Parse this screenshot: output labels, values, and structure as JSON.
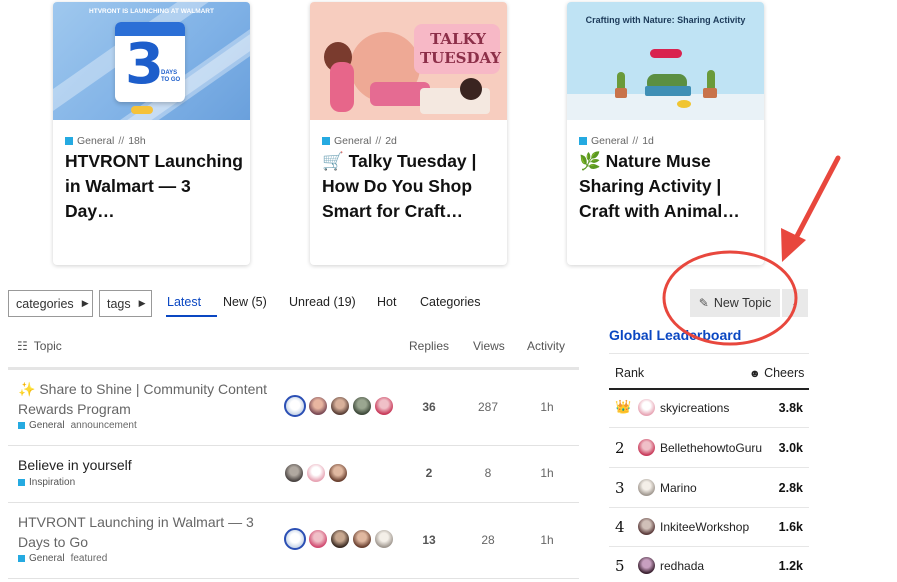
{
  "featured": [
    {
      "category": "General",
      "age": "18h",
      "title": "HTVRONT Launching in Walmart — 3 Day…",
      "thumb": {
        "header": "HTVRONT IS LAUNCHING AT WALMART",
        "number": "3",
        "sub": "DAYS TO GO"
      }
    },
    {
      "category": "General",
      "age": "2d",
      "title": "🛒 Talky Tuesday | How Do You Shop Smart for Craft…",
      "thumb": {
        "sign_text": "TALKY TUESDAY"
      }
    },
    {
      "category": "General",
      "age": "1d",
      "title": "🌿 Nature Muse Sharing Activity | Craft with Animal…",
      "thumb": {
        "title": "Crafting with Nature: Sharing Activity"
      }
    }
  ],
  "nav": {
    "categories_label": "categories",
    "tags_label": "tags",
    "links": [
      "Latest",
      "New (5)",
      "Unread (19)",
      "Hot",
      "Categories"
    ],
    "active": "Latest",
    "new_topic_label": "New Topic"
  },
  "table": {
    "headers": {
      "topic": "Topic",
      "replies": "Replies",
      "views": "Views",
      "activity": "Activity"
    },
    "rows": [
      {
        "title": "✨ Share to Shine | Community Content Rewards Program",
        "category": "General",
        "tags": [
          "announcement"
        ],
        "replies": "36",
        "views": "287",
        "activity": "1h"
      },
      {
        "title": "Believe in yourself",
        "category": "Inspiration",
        "tags": [],
        "replies": "2",
        "views": "8",
        "activity": "1h"
      },
      {
        "title": "HTVRONT Launching in Walmart — 3 Days to Go",
        "category": "General",
        "tags": [
          "featured"
        ],
        "replies": "13",
        "views": "28",
        "activity": "1h"
      }
    ]
  },
  "leaderboard": {
    "title": "Global Leaderboard",
    "rank_header": "Rank",
    "score_header": "Cheers",
    "entries": [
      {
        "rank": "👑",
        "name": "skyicreations",
        "score": "3.8k"
      },
      {
        "rank": "2",
        "name": "BellethehowtoGuru",
        "score": "3.0k"
      },
      {
        "rank": "3",
        "name": "Marino",
        "score": "2.8k"
      },
      {
        "rank": "4",
        "name": "InkiteeWorkshop",
        "score": "1.6k"
      },
      {
        "rank": "5",
        "name": "redhada",
        "score": "1.2k"
      }
    ]
  },
  "colors": {
    "accent": "#0a47c2",
    "category_general": "#25aae1",
    "annotation": "#e8473d"
  }
}
